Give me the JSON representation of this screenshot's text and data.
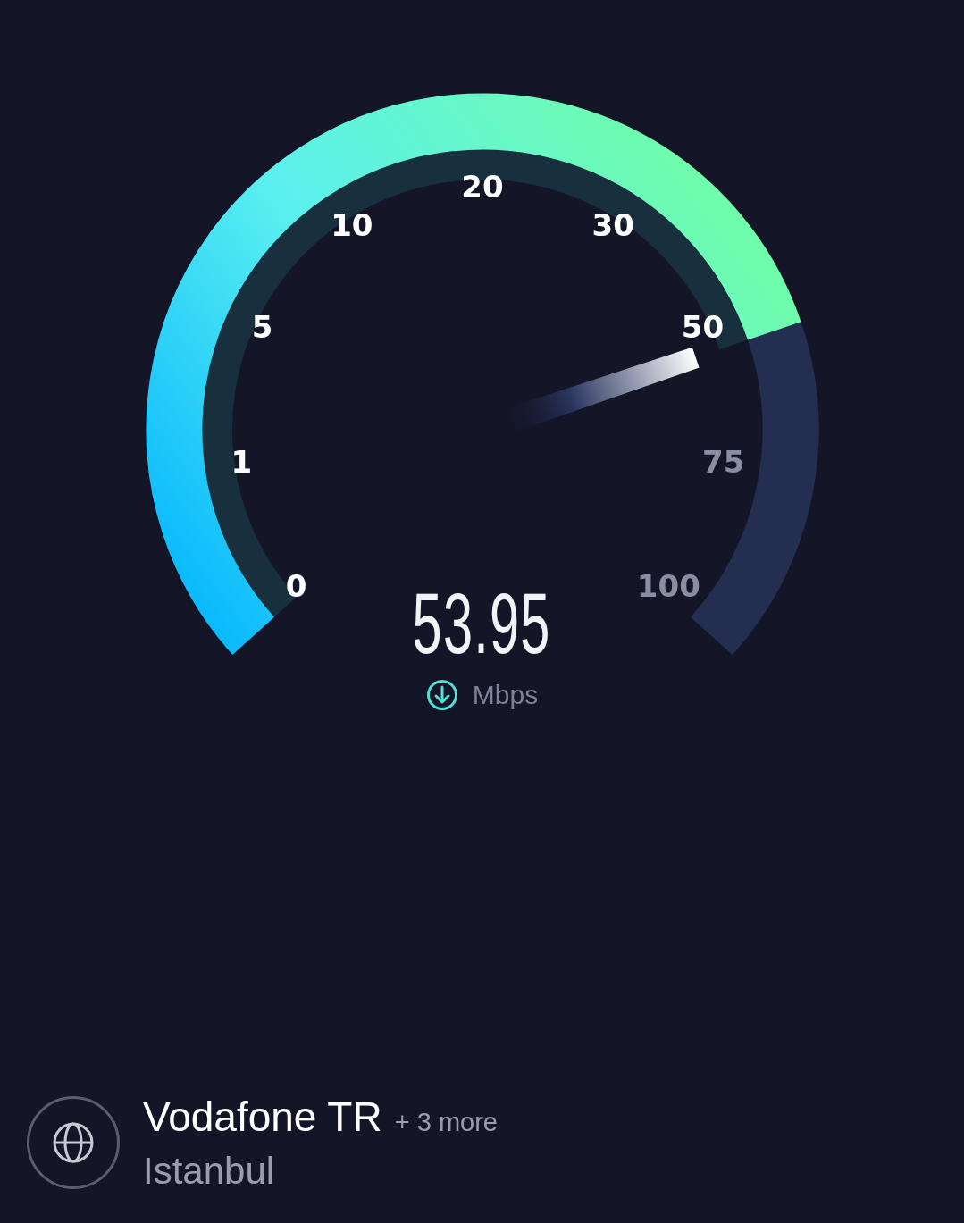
{
  "gauge": {
    "ticks": [
      {
        "label": "0",
        "passed": true
      },
      {
        "label": "1",
        "passed": true
      },
      {
        "label": "5",
        "passed": true
      },
      {
        "label": "10",
        "passed": true
      },
      {
        "label": "20",
        "passed": true
      },
      {
        "label": "30",
        "passed": true
      },
      {
        "label": "50",
        "passed": true
      },
      {
        "label": "75",
        "passed": false
      },
      {
        "label": "100",
        "passed": false
      }
    ],
    "reading": "53.95",
    "unit": "Mbps"
  },
  "provider": {
    "name": "Vodafone TR",
    "more": "+ 3 more",
    "location": "Istanbul"
  }
}
